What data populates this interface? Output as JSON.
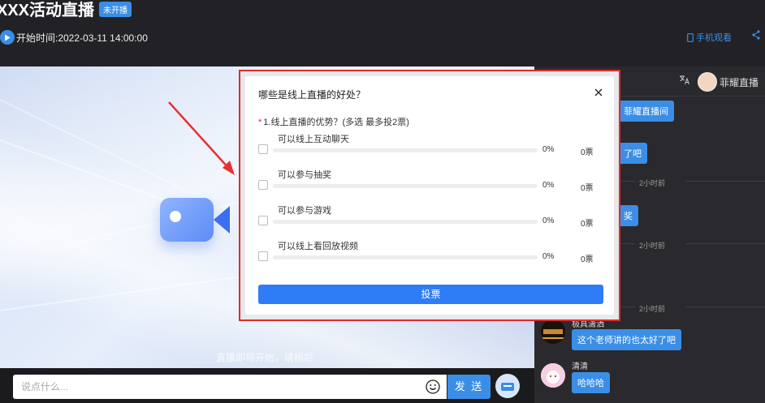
{
  "header": {
    "title": "XXX活动直播",
    "status_badge": "未开播",
    "start_time": "开始时间:2022-03-11 14:00:00",
    "mobile_watch": "手机观看",
    "share_icon": "share-icon"
  },
  "stage": {
    "caption": "直播即将开始，请稍后",
    "camera_icon": "video-camera-icon"
  },
  "chat_input": {
    "placeholder": "说点什么...",
    "send_label": "发 送"
  },
  "sidebar": {
    "host_name": "菲耀直播",
    "messages": [
      {
        "text": "菲耀直播间"
      },
      {
        "text": "了吧"
      },
      {
        "time": "2小时前"
      },
      {
        "text": "奖"
      },
      {
        "time": "2小时前"
      },
      {
        "time": "2小时前"
      },
      {
        "user": "极具潇洒",
        "text": "这个老师讲的也太好了吧"
      },
      {
        "user": "清清",
        "text": "哈哈哈"
      }
    ]
  },
  "poll": {
    "title": "哪些是线上直播的好处？",
    "question": "1.线上直播的优势？(多选 最多投2票)",
    "required_mark": "*",
    "options": [
      {
        "label": "可以线上互动聊天",
        "percent": "0%",
        "votes": "0票",
        "fill": 0
      },
      {
        "label": "可以参与抽奖",
        "percent": "0%",
        "votes": "0票",
        "fill": 0
      },
      {
        "label": "可以参与游戏",
        "percent": "0%",
        "votes": "0票",
        "fill": 0
      },
      {
        "label": "可以线上看回放视频",
        "percent": "0%",
        "votes": "0票",
        "fill": 0
      }
    ],
    "vote_label": "投票",
    "close_icon": "close-icon"
  },
  "colors": {
    "accent": "#3a8ee6",
    "highlight_border": "#e02b2b"
  }
}
